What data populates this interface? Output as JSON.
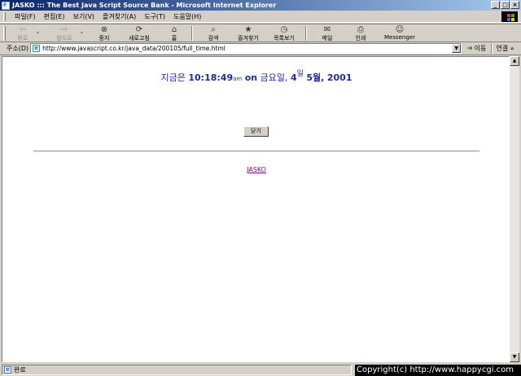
{
  "window": {
    "title": "JASKO ::: The Best Java Script Source Bank - Microsoft Internet Explorer",
    "buttons": [
      "_",
      "□",
      "×"
    ]
  },
  "menu": {
    "items": [
      "파일(F)",
      "편집(E)",
      "보기(V)",
      "즐겨찾기(A)",
      "도구(T)",
      "도움말(H)"
    ]
  },
  "toolbar": {
    "buttons": [
      {
        "label": "뒤로",
        "icon": "back-arrow-icon",
        "glyph": "⇦"
      },
      {
        "label": "앞으로",
        "icon": "forward-arrow-icon",
        "glyph": "⇨"
      },
      {
        "label": "중지",
        "icon": "stop-icon",
        "glyph": "⊗"
      },
      {
        "label": "새로고침",
        "icon": "refresh-icon",
        "glyph": "⟳"
      },
      {
        "label": "홈",
        "icon": "home-icon",
        "glyph": "⌂"
      },
      {
        "label": "검색",
        "icon": "search-icon",
        "glyph": "⌕"
      },
      {
        "label": "즐겨찾기",
        "icon": "favorites-icon",
        "glyph": "★"
      },
      {
        "label": "목록보기",
        "icon": "history-icon",
        "glyph": "◷"
      },
      {
        "label": "메일",
        "icon": "mail-icon",
        "glyph": "✉"
      },
      {
        "label": "인쇄",
        "icon": "print-icon",
        "glyph": "⎙"
      },
      {
        "label": "Messenger",
        "icon": "messenger-icon",
        "glyph": "☺"
      }
    ]
  },
  "address": {
    "label": "주소(D)",
    "url": "http://www.javascript.co.kr/java_data/200105/full_time.html",
    "go_label": "이동",
    "links_label": "연결 »"
  },
  "page": {
    "time_prefix": "지금은",
    "time_value": "10:18:49",
    "ampm": "am",
    "on_word": "on",
    "weekday": "금요일,",
    "day": "4",
    "day_suffix": "일",
    "month": "5월,",
    "year": "2001",
    "close_button": "닫기",
    "link_text": "JASKO"
  },
  "status": {
    "text": "완료",
    "copyright": "Copyright(c) http://www.happycgi.com"
  }
}
